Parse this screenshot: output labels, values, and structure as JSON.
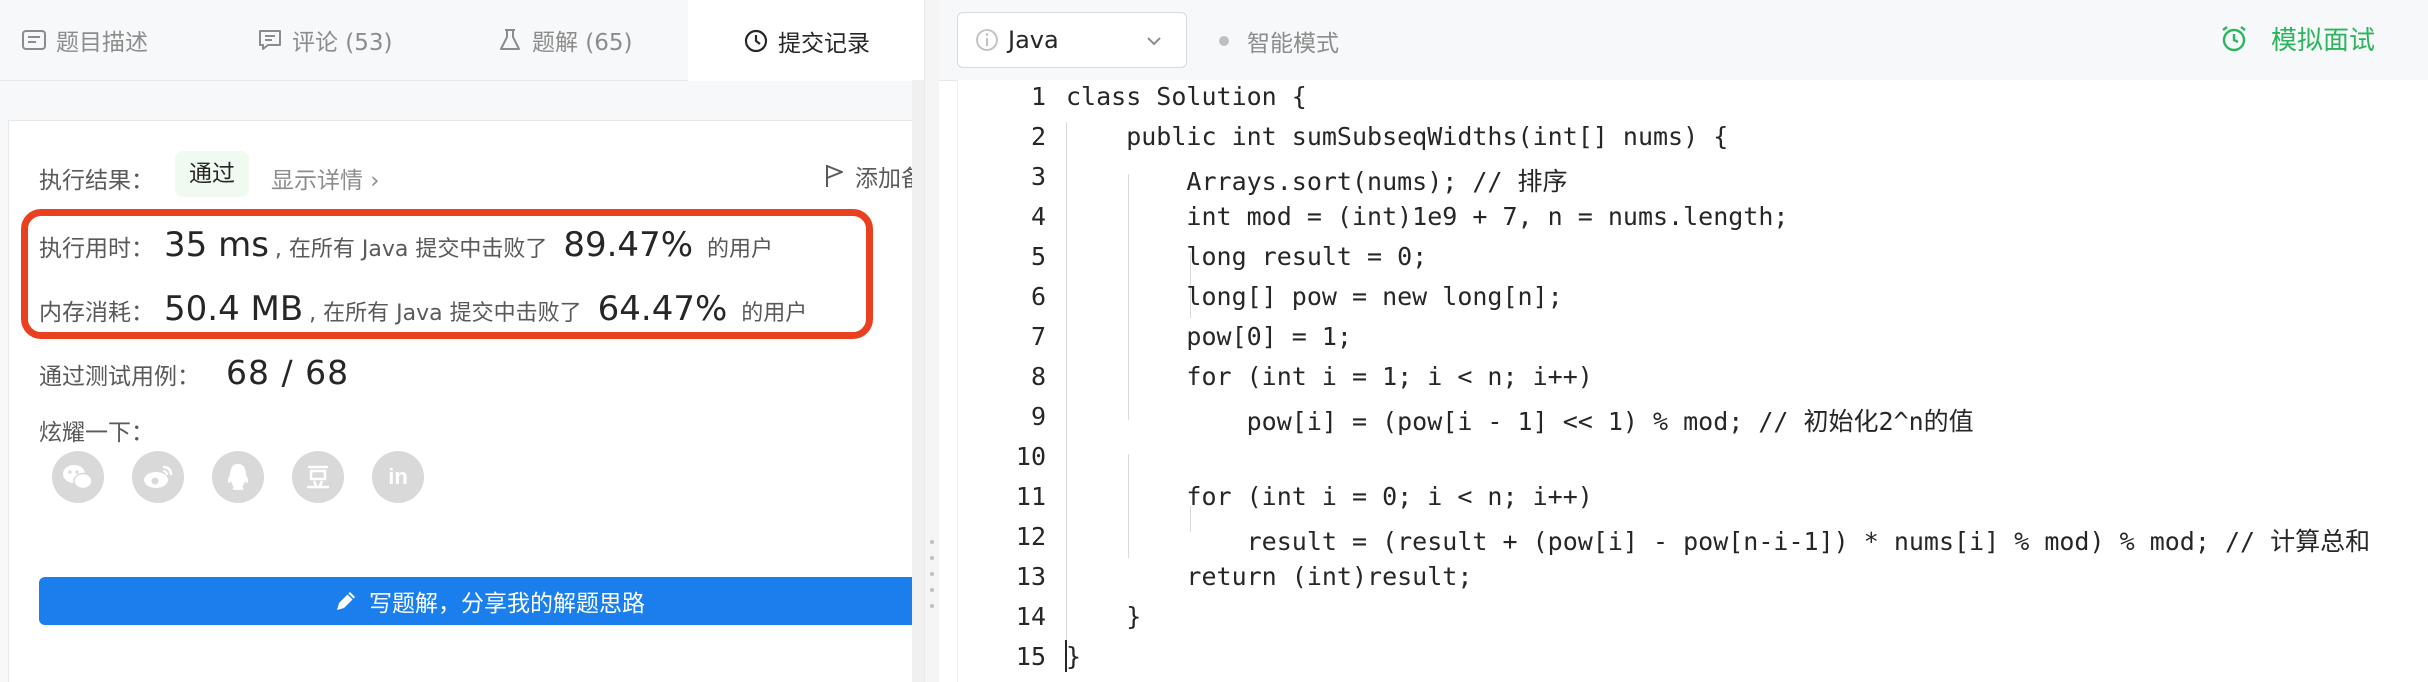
{
  "tabs": [
    {
      "label": "题目描述",
      "icon": "description-icon"
    },
    {
      "label": "评论 (53)",
      "icon": "comment-icon"
    },
    {
      "label": "题解 (65)",
      "icon": "flask-icon"
    },
    {
      "label": "提交记录",
      "icon": "clock-icon"
    }
  ],
  "result": {
    "label": "执行结果：",
    "status": "通过",
    "detail": "显示详情 ›",
    "add_note": "添加备"
  },
  "stats": {
    "time_label": "执行用时：",
    "time_value": "35 ms",
    "time_text": ", 在所有 Java 提交中击败了",
    "time_pct": "89.47%",
    "time_suffix": "的用户",
    "mem_label": "内存消耗：",
    "mem_value": "50.4 MB",
    "mem_text": ", 在所有 Java 提交中击败了",
    "mem_pct": "64.47%",
    "mem_suffix": "的用户",
    "highlight_color": "#e9411f"
  },
  "tests": {
    "label": "通过测试用例：",
    "value": "68 / 68"
  },
  "share": {
    "label": "炫耀一下：",
    "icons": [
      "wechat-icon",
      "weibo-icon",
      "qq-icon",
      "douban-icon",
      "linkedin-icon"
    ]
  },
  "write_button": "写题解，分享我的解题思路",
  "toolbar": {
    "language": "Java",
    "smart_mode": "智能模式",
    "mock_interview": "模拟面试",
    "accent": "#2db55d"
  },
  "code": {
    "line_numbers": [
      "1",
      "2",
      "3",
      "4",
      "5",
      "6",
      "7",
      "8",
      "9",
      "10",
      "11",
      "12",
      "13",
      "14",
      "15"
    ],
    "lines": [
      "class Solution {",
      "    public int sumSubseqWidths(int[] nums) {",
      "        Arrays.sort(nums); // 排序",
      "        int mod = (int)1e9 + 7, n = nums.length;",
      "        long result = 0;",
      "        long[] pow = new long[n];",
      "        pow[0] = 1;",
      "        for (int i = 1; i < n; i++)",
      "            pow[i] = (pow[i - 1] << 1) % mod; // 初始化2^n的值",
      "",
      "        for (int i = 0; i < n; i++)",
      "            result = (result + (pow[i] - pow[n-i-1]) * nums[i] % mod) % mod; // 计算总和",
      "        return (int)result;",
      "    }",
      "}"
    ]
  }
}
